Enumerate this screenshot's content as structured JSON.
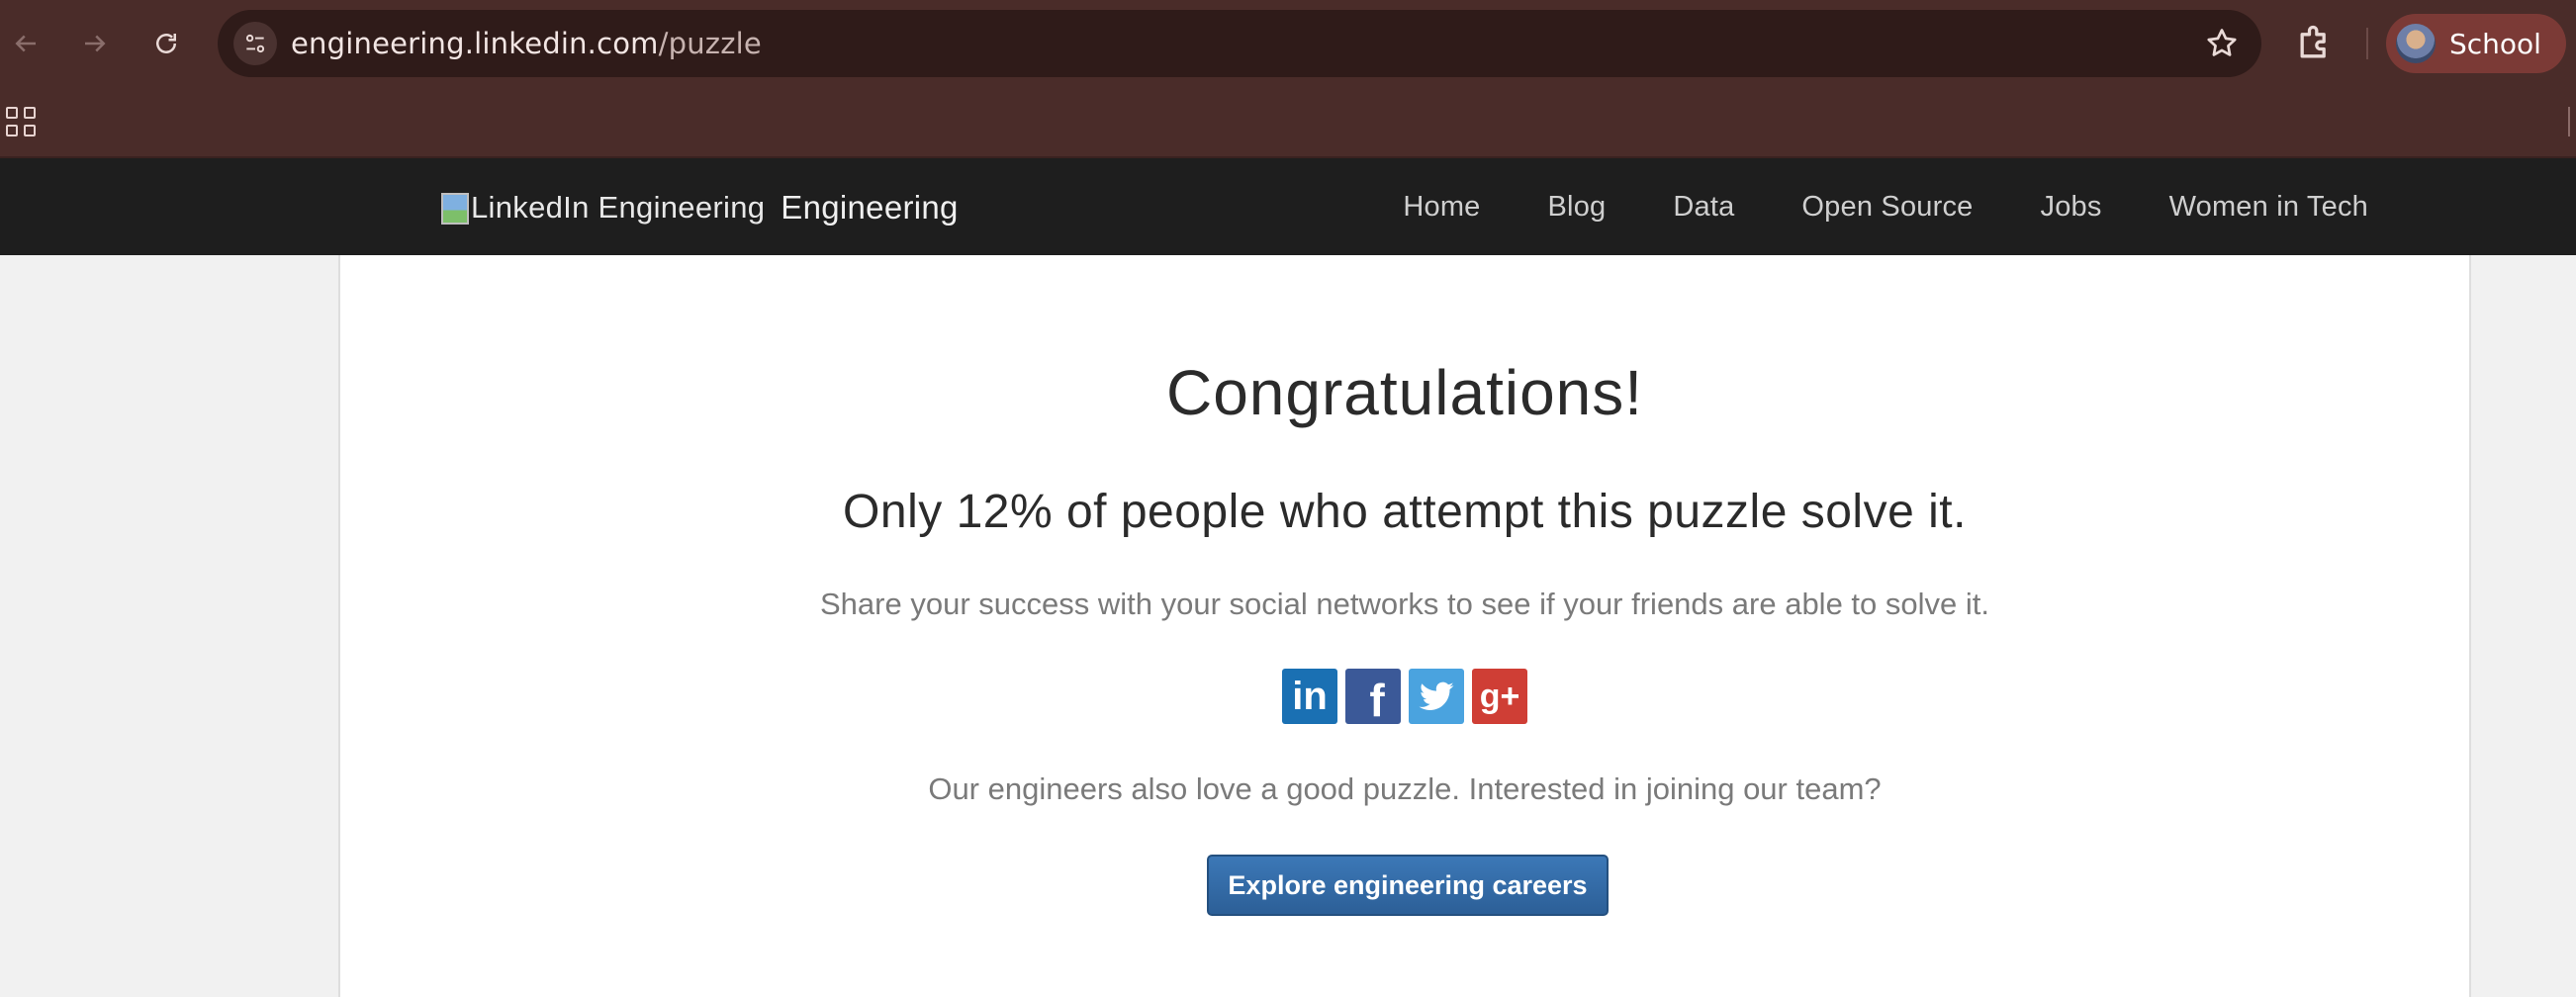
{
  "browser": {
    "url_host": "engineering.linkedin.com",
    "url_path": "/puzzle",
    "profile_label": "School"
  },
  "site": {
    "logo_alt": "LinkedIn Engineering",
    "logo_text": "Engineering",
    "nav": [
      "Home",
      "Blog",
      "Data",
      "Open Source",
      "Jobs",
      "Women in Tech"
    ]
  },
  "content": {
    "title": "Congratulations!",
    "subtitle": "Only 12% of people who attempt this puzzle solve it.",
    "share_text": "Share your success with your social networks to see if your friends are able to solve it.",
    "social": [
      {
        "name": "linkedin-icon",
        "glyph": "in",
        "color": "#1a70b3"
      },
      {
        "name": "facebook-icon",
        "glyph": "f",
        "color": "#3b5998"
      },
      {
        "name": "twitter-icon",
        "glyph": "",
        "color": "#4aa3df"
      },
      {
        "name": "google-plus-icon",
        "glyph": "g+",
        "color": "#cf3e35"
      }
    ],
    "team_text": "Our engineers also love a good puzzle. Interested in joining our team?",
    "cta_label": "Explore engineering careers"
  }
}
